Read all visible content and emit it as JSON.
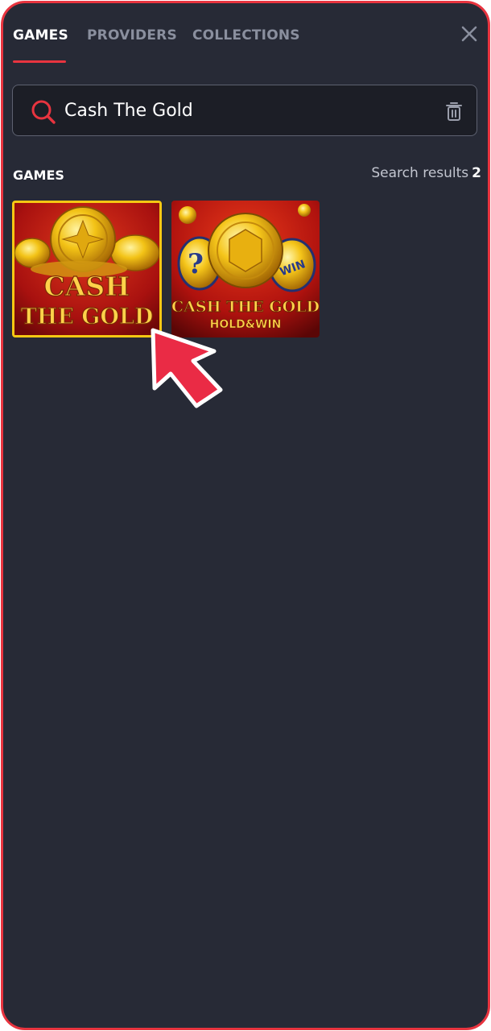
{
  "tabs": [
    {
      "label": "GAMES",
      "active": true
    },
    {
      "label": "PROVIDERS",
      "active": false
    },
    {
      "label": "COLLECTIONS",
      "active": false
    }
  ],
  "search": {
    "value": "Cash The Gold",
    "icon": "search-icon",
    "clear_icon": "trash-icon"
  },
  "section": {
    "title": "GAMES",
    "results_label": "Search results",
    "results_count": "2"
  },
  "games": [
    {
      "title_line1": "CASH",
      "title_line2": "THE GOLD",
      "selected": true
    },
    {
      "title_line1": "CASH THE GOLD",
      "title_line2": "HOLD&WIN",
      "selected": false
    }
  ],
  "colors": {
    "accent": "#e8343f",
    "background": "#272a36",
    "selected_border": "#f6c813"
  }
}
